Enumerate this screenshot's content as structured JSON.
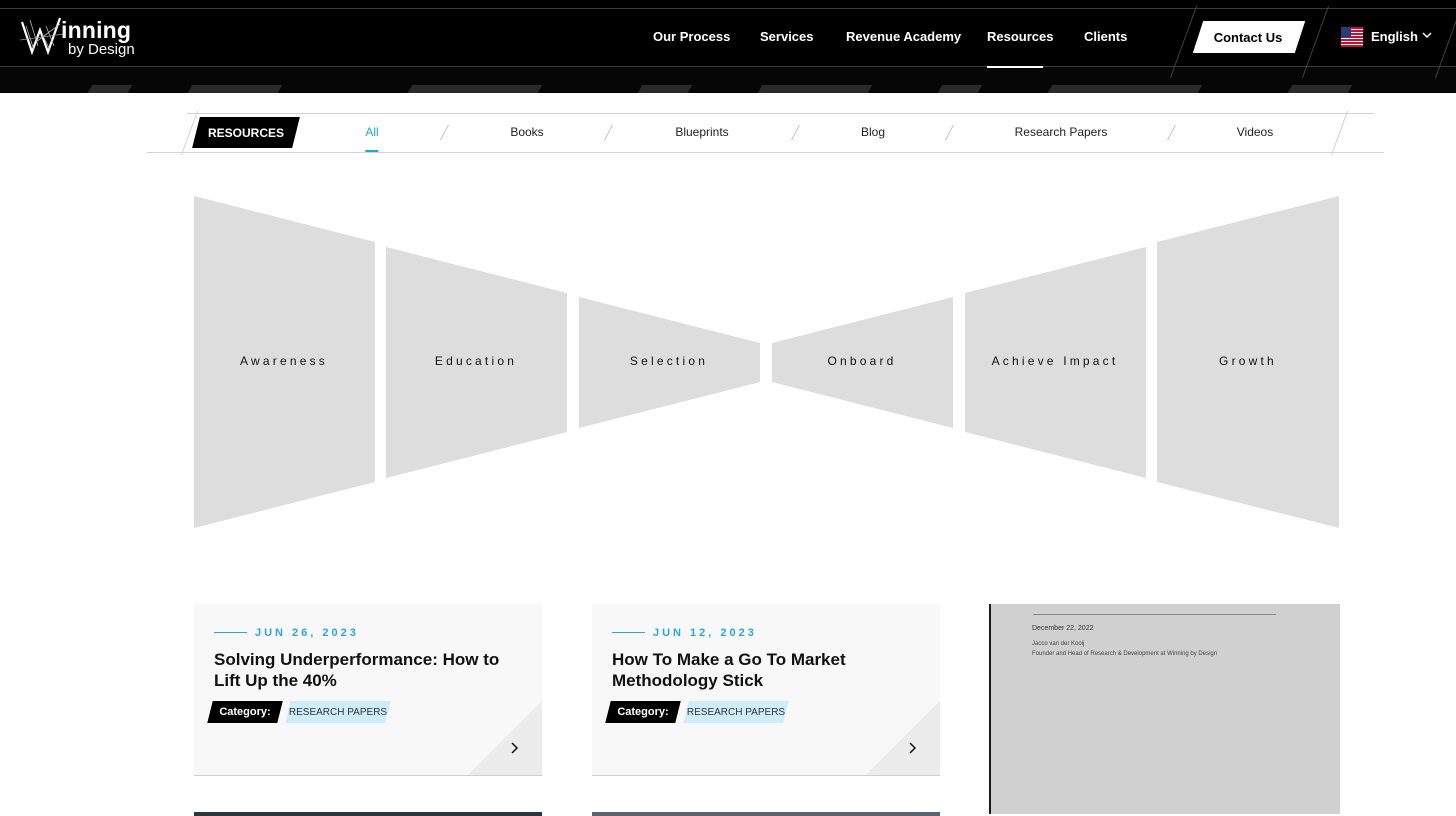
{
  "header": {
    "logo_word1": "inning",
    "logo_word2": "by Design",
    "nav": [
      {
        "label": "Our Process"
      },
      {
        "label": "Services"
      },
      {
        "label": "Revenue Academy"
      },
      {
        "label": "Resources",
        "active": true
      },
      {
        "label": "Clients"
      }
    ],
    "contact_label": "Contact Us",
    "language_label": "English"
  },
  "filters": {
    "badge": "RESOURCES",
    "tabs": [
      {
        "label": "All",
        "active": true
      },
      {
        "label": "Books"
      },
      {
        "label": "Blueprints"
      },
      {
        "label": "Blog"
      },
      {
        "label": "Research Papers"
      },
      {
        "label": "Videos"
      }
    ]
  },
  "bowtie": {
    "stages": [
      "Awareness",
      "Education",
      "Selection",
      "Onboard",
      "Achieve Impact",
      "Growth"
    ],
    "fill_color": "#dddddd"
  },
  "cards": [
    {
      "date": "JUN 26, 2023",
      "title": "Solving Underperformance: How to Lift Up the 40%",
      "category_label": "Category:",
      "tag": "RESEARCH PAPERS"
    },
    {
      "date": "JUN 12, 2023",
      "title": "How To Make a Go To Market Methodology Stick",
      "category_label": "Category:",
      "tag": "RESEARCH PAPERS"
    }
  ],
  "preview_document": {
    "date": "December 22, 2022",
    "author": "Jacco van der Kooij",
    "role": "Founder and Head of Research & Development at Winning by Design"
  },
  "colors": {
    "accent": "#1ea7d6",
    "header_bg": "#000000",
    "tag_bg": "#cdeef9"
  }
}
